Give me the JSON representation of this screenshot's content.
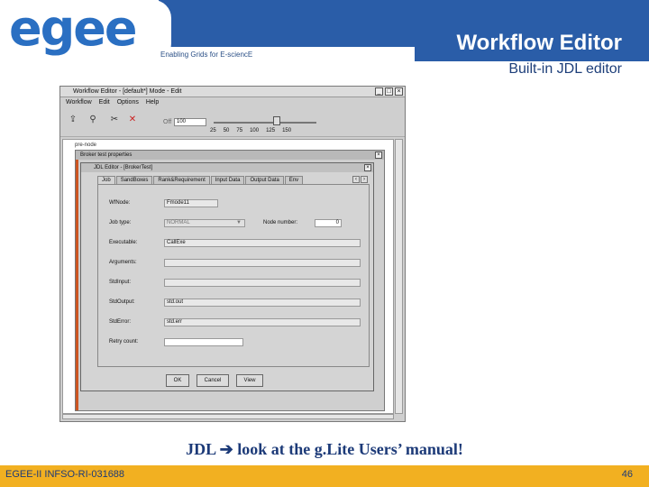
{
  "header": {
    "logo_text": "egee",
    "tagline": "Enabling Grids for E-sciencE",
    "title": "Workflow Editor",
    "subtitle": "Built-in JDL editor",
    "band_color": "#2a5da8"
  },
  "app_window": {
    "title": "Workflow Editor - [default*] Mode - Edit",
    "window_buttons": [
      "_",
      "□",
      "×"
    ],
    "menu": [
      "Workflow",
      "Edit",
      "Options",
      "Help"
    ],
    "toolbar": {
      "icons": [
        "open-icon",
        "connect-icon",
        "cut-icon",
        "delete-icon"
      ],
      "zoom_label": "Off",
      "zoom_value": "100",
      "slider_ticks": [
        "25",
        "50",
        "75",
        "100",
        "125",
        "150"
      ],
      "slider_value": 100
    },
    "canvas_node_label": "pre-node",
    "node_properties": {
      "title": "Broker test properties",
      "close": "×"
    },
    "jdl_editor": {
      "title": "JDL Editor - [BrokerTest]",
      "close": "×",
      "tabs": [
        "Job",
        "SandBoxes",
        "Rank&Requirement",
        "Input Data",
        "Output Data",
        "Env"
      ],
      "active_tab": "Job",
      "fields": {
        "wf_name": {
          "label": "WfNode:",
          "value": "Fmode11"
        },
        "job_type": {
          "label": "Job type:",
          "value": "NORMAL",
          "arrow": "▼"
        },
        "node_number": {
          "label": "Node number:",
          "value": "0"
        },
        "executable": {
          "label": "Executable:",
          "value": "CallExe"
        },
        "arguments": {
          "label": "Arguments:",
          "value": ""
        },
        "std_input": {
          "label": "StdInput:",
          "value": ""
        },
        "std_output": {
          "label": "StdOutput:",
          "value": "std.out"
        },
        "std_error": {
          "label": "StdError:",
          "value": "std.err"
        },
        "retry_count": {
          "label": "Retry count:",
          "value": ""
        }
      },
      "buttons": {
        "ok": "OK",
        "cancel": "Cancel",
        "view": "View"
      }
    }
  },
  "caption": {
    "prefix": "JDL",
    "arrow": "➔",
    "text": "look at the g.Lite Users’ manual!"
  },
  "footer": {
    "left": "EGEE-II INFSO-RI-031688",
    "page": "46",
    "band_color": "#f2b021"
  }
}
